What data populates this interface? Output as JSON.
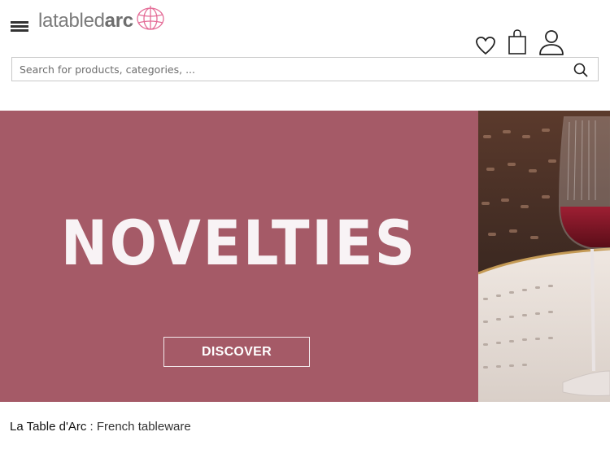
{
  "header": {
    "menu_icon": "hamburger-menu-icon",
    "logo": {
      "text_light": "latabled",
      "text_bold": "arc",
      "mark_icon": "globe-logo-icon"
    },
    "actions": [
      {
        "name": "wishlist",
        "icon": "heart-icon"
      },
      {
        "name": "cart",
        "icon": "shopping-bag-icon"
      },
      {
        "name": "account",
        "icon": "user-icon"
      }
    ]
  },
  "search": {
    "placeholder": "Search for products, categories, ...",
    "icon": "search-icon"
  },
  "hero": {
    "title": "NOVELTIES",
    "cta_label": "DISCOVER",
    "background_color": "#a55a67"
  },
  "footer": {
    "brand": "La Table d'Arc",
    "separator": " : ",
    "tagline": "French tableware"
  }
}
